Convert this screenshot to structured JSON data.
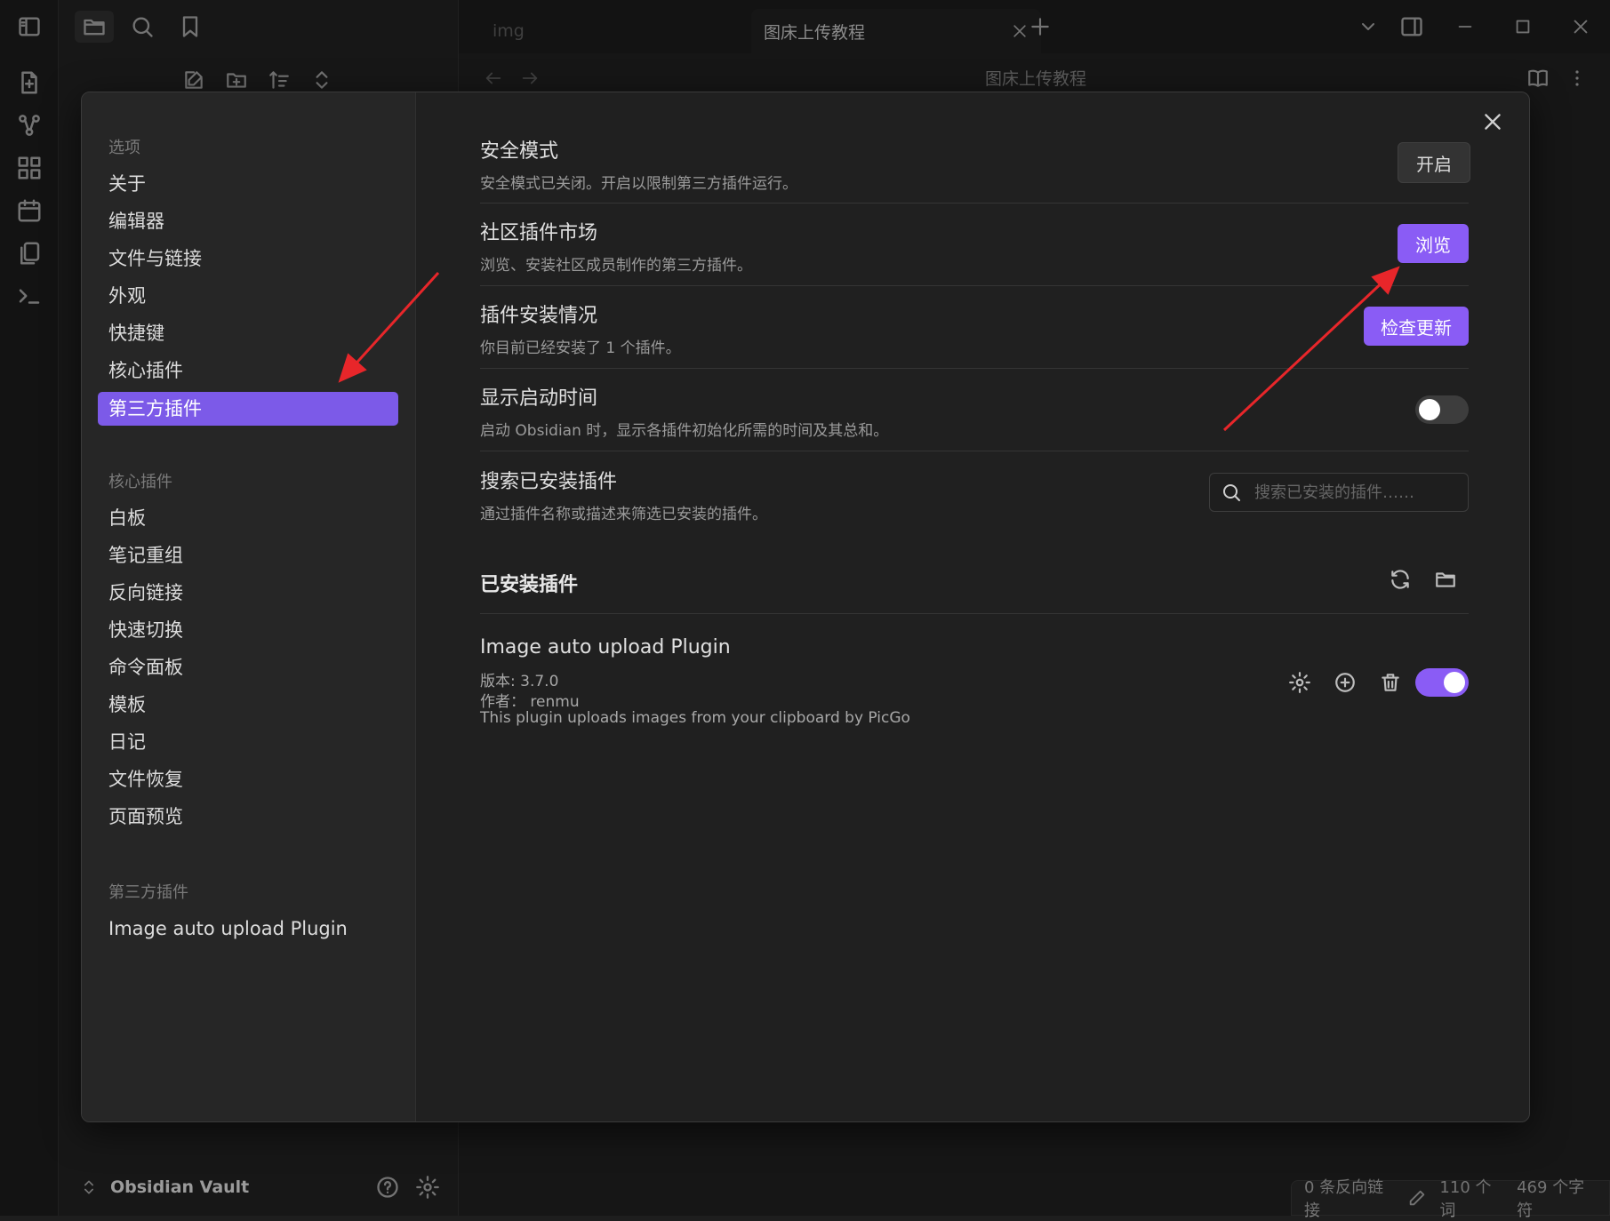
{
  "tabs": {
    "inactive": "img",
    "active": "图床上传教程"
  },
  "note_title": "图床上传教程",
  "vault": {
    "name": "Obsidian Vault"
  },
  "status": {
    "backlinks": "0 条反向链接",
    "words": "110 个词",
    "chars": "469 个字符"
  },
  "modal": {
    "nav": {
      "options_heading": "选项",
      "options": [
        "关于",
        "编辑器",
        "文件与链接",
        "外观",
        "快捷键",
        "核心插件"
      ],
      "active": "第三方插件",
      "core_heading": "核心插件",
      "core": [
        "白板",
        "笔记重组",
        "反向链接",
        "快速切换",
        "命令面板",
        "模板",
        "日记",
        "文件恢复",
        "页面预览"
      ],
      "community_heading": "第三方插件",
      "community": [
        "Image auto upload Plugin"
      ]
    },
    "rows": {
      "safe_mode": {
        "title": "安全模式",
        "desc": "安全模式已关闭。开启以限制第三方插件运行。",
        "button": "开启"
      },
      "market": {
        "title": "社区插件市场",
        "desc": "浏览、安装社区成员制作的第三方插件。",
        "button": "浏览"
      },
      "installed_status": {
        "title": "插件安装情况",
        "desc": "你目前已经安装了 1 个插件。",
        "button": "检查更新"
      },
      "startup_time": {
        "title": "显示启动时间",
        "desc": "启动 Obsidian 时，显示各插件初始化所需的时间及其总和。",
        "enabled": false
      },
      "search": {
        "title": "搜索已安装插件",
        "desc": "通过插件名称或描述来筛选已安装的插件。",
        "placeholder": "搜索已安装的插件……"
      }
    },
    "installed": {
      "heading": "已安装插件",
      "plugin": {
        "name": "Image auto upload Plugin",
        "version": "版本: 3.7.0",
        "author": "作者： renmu",
        "description": "This plugin uploads images from your clipboard by PicGo",
        "enabled": true
      }
    }
  },
  "colors": {
    "accent": "#8a5cf5",
    "annotation_arrow": "#e8262a"
  }
}
